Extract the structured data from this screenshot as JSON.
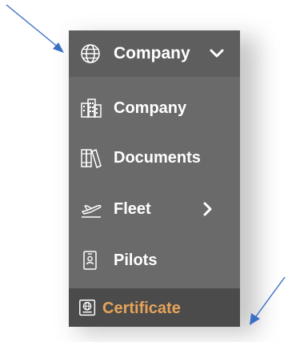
{
  "menu": {
    "header": {
      "label": "Company",
      "icon": "globe-icon",
      "chevron": "chevron-down-icon"
    },
    "items": [
      {
        "label": "Company",
        "icon": "buildings-icon"
      },
      {
        "label": "Documents",
        "icon": "books-icon"
      },
      {
        "label": "Fleet",
        "icon": "airplane-icon",
        "chevron": "chevron-right-icon"
      },
      {
        "label": "Pilots",
        "icon": "id-badge-icon"
      },
      {
        "label": "Certificate",
        "icon": "certificate-icon",
        "highlighted": true
      }
    ]
  },
  "colors": {
    "menu_bg": "#6a6a6a",
    "header_bg": "#5e5e5e",
    "active_bg": "#4b4b4b",
    "text": "#ffffff",
    "active_text": "#e7a35a",
    "annotation_arrow": "#3a6fc4"
  },
  "annotations": [
    {
      "icon": "arrow-icon",
      "target": "menu-header"
    },
    {
      "icon": "arrow-icon",
      "target": "menu-item-certificate"
    }
  ]
}
